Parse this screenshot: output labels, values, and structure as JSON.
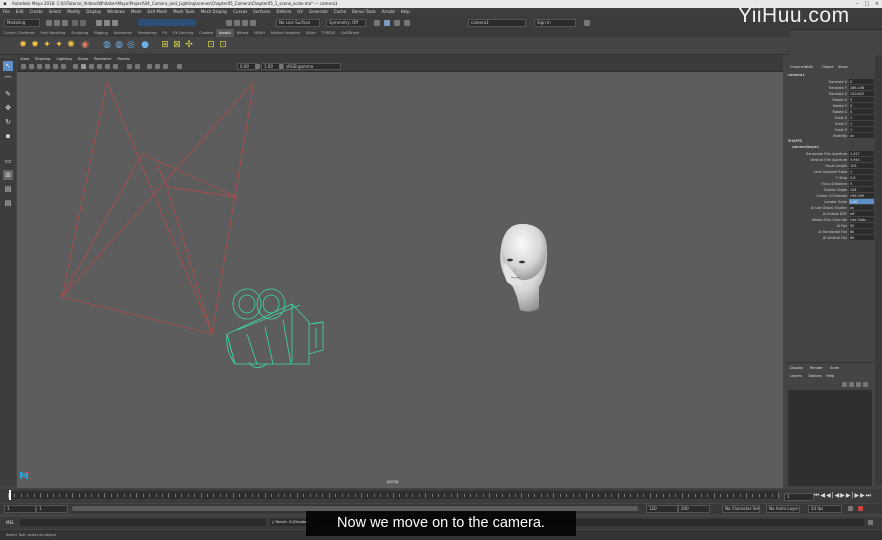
{
  "title_bar": {
    "text": "Autodesk Maya 2018: C:\\lil\\Tutorial_Videos\\Whitaker\\Maya\\Project\\04_Camera_and_Lighting\\scenes\\Chapter05_Camera\\Chapter05_1_scene_scale.ma* --- camera1"
  },
  "menubar": [
    "File",
    "Edit",
    "Create",
    "Select",
    "Modify",
    "Display",
    "Windows",
    "Mesh",
    "Edit Mesh",
    "Mesh Tools",
    "Mesh Display",
    "Curves",
    "Surfaces",
    "Deform",
    "UV",
    "Generate",
    "Cache",
    "Bonus Tools",
    "Arnold",
    "Help"
  ],
  "statusline": {
    "mode": "Modeling",
    "live_surface": "No Live Surface",
    "symmetry": "Symmetry: Off",
    "object_name": "camera1",
    "sign_in": "Sign In"
  },
  "shelf_tabs": [
    "Curves / Surfaces",
    "Poly Modeling",
    "Sculpting",
    "Rigging",
    "Animation",
    "Rendering",
    "FX",
    "FX Caching",
    "Custom",
    "Arnold",
    "Bifrost",
    "MASH",
    "Motion Graphics",
    "XGen",
    "TURTLE",
    "GoZBrush"
  ],
  "shelf_active": "Arnold",
  "panel_menu": [
    "View",
    "Shading",
    "Lighting",
    "Show",
    "Renderer",
    "Panels"
  ],
  "viewbar": {
    "near": "0.00",
    "scale": "1.00",
    "colorspace": "sRGB gamma"
  },
  "viewport": {
    "label": "persp"
  },
  "channel_box": {
    "tabs": [
      "Channels",
      "Edit",
      "Object",
      "Show"
    ],
    "object": "camera1",
    "transform": [
      {
        "name": "Translate X",
        "value": "0"
      },
      {
        "name": "Translate Y",
        "value": "286.146"
      },
      {
        "name": "Translate Z",
        "value": "120.825"
      },
      {
        "name": "Rotate X",
        "value": "0"
      },
      {
        "name": "Rotate Y",
        "value": "0"
      },
      {
        "name": "Rotate Z",
        "value": "0"
      },
      {
        "name": "Scale X",
        "value": "1"
      },
      {
        "name": "Scale Y",
        "value": "1"
      },
      {
        "name": "Scale Z",
        "value": "1"
      },
      {
        "name": "Visibility",
        "value": "on"
      }
    ],
    "shapes_header": "SHAPES",
    "shape_name": "cameraShape1",
    "shape_attrs": [
      {
        "name": "Horizontal Film Aperture",
        "value": "1.417"
      },
      {
        "name": "Vertical Film Aperture",
        "value": "0.945"
      },
      {
        "name": "Focal Length",
        "value": "105"
      },
      {
        "name": "Lens Squeeze Ratio",
        "value": "1"
      },
      {
        "name": "F Stop",
        "value": "5.6"
      },
      {
        "name": "Focus Distance",
        "value": "5"
      },
      {
        "name": "Shutter Angle",
        "value": "144"
      },
      {
        "name": "Center Of Interest",
        "value": "296.399"
      },
      {
        "name": "Locator Scale",
        "value": "1.00",
        "highlight": true
      },
      {
        "name": "Ai Use Global Shutter",
        "value": "on"
      },
      {
        "name": "Ai Enable DOF",
        "value": "off"
      },
      {
        "name": "Motion Blur Override",
        "value": "Use Glob..."
      },
      {
        "name": "Ai Fov",
        "value": "90"
      },
      {
        "name": "Ai Horizontal Fov",
        "value": "60"
      },
      {
        "name": "Ai Vertical Fov",
        "value": "60"
      }
    ]
  },
  "layer_panel": {
    "tabs": [
      "Display",
      "Render",
      "Anim"
    ],
    "menu": [
      "Layers",
      "Options",
      "Help"
    ]
  },
  "timeline": {
    "current_frame": "1",
    "start": "1",
    "range_start": "1",
    "range_end": "120",
    "end": "200",
    "end2": "120",
    "no_character": "No Character Set",
    "no_anim_layer": "No Anim Layer",
    "fps": "24 fps"
  },
  "command_line": {
    "lang": "MEL",
    "result": "// Result: D:/Dropbox/..."
  },
  "help_line": "Select Tool: select an object",
  "subtitle": "Now we move on to the camera.",
  "watermark": "YiiHuu.com",
  "colors": {
    "accent": "#5b8fc7",
    "camera_wire": "#3fd9a0",
    "frustum": "#b84a4a"
  }
}
